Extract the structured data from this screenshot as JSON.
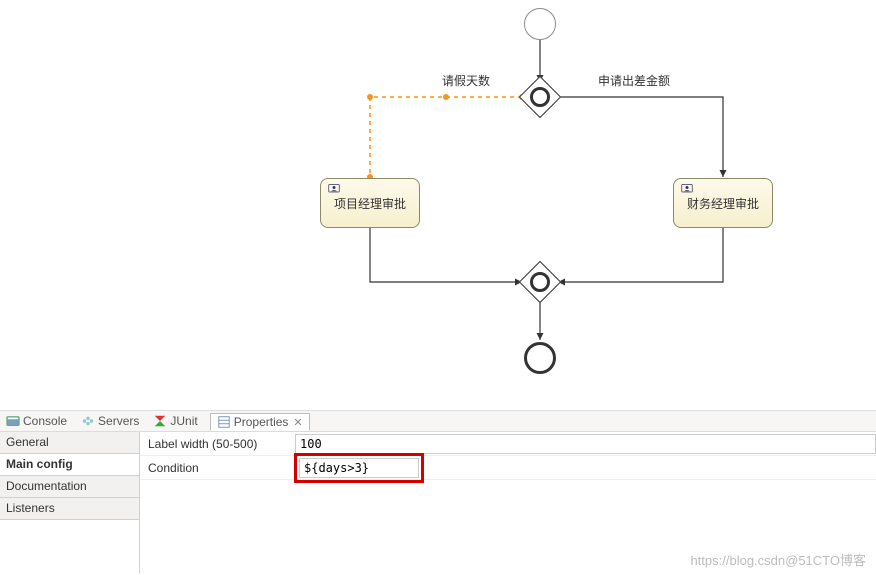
{
  "diagram": {
    "labels": {
      "left_flow": "请假天数",
      "right_flow": "申请出差金额"
    },
    "tasks": {
      "task1": "项目经理审批",
      "task2": "财务经理审批"
    }
  },
  "tab_bar": {
    "console": "Console",
    "servers": "Servers",
    "junit": "JUnit",
    "properties": "Properties",
    "close_x": "✕"
  },
  "side_tabs": {
    "general": "General",
    "main_config": "Main config",
    "documentation": "Documentation",
    "listeners": "Listeners"
  },
  "props": {
    "label_width_label": "Label width (50-500)",
    "label_width_value": "100",
    "condition_label": "Condition",
    "condition_value": "${days>3}"
  },
  "watermark": "https://blog.csdn@51CTO博客"
}
